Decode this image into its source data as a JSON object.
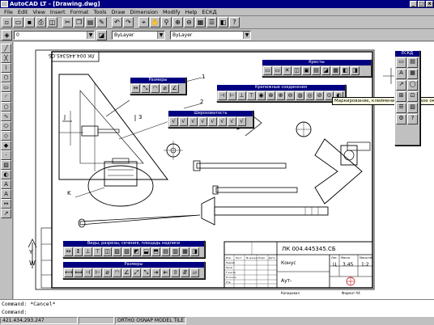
{
  "window": {
    "title": "AutoCAD LT - [Drawing.dwg]",
    "min": "_",
    "max": "□",
    "close": "x"
  },
  "menu": [
    "File",
    "Edit",
    "View",
    "Insert",
    "Format",
    "Tools",
    "Draw",
    "Dimension",
    "Modify",
    "Help",
    "ЕСКД"
  ],
  "props": {
    "layer": "0",
    "color": "ByLayer",
    "linetype": "ByLayer"
  },
  "panels": {
    "sizes": "Размеры",
    "roughness": "Шероховатость",
    "threaded": "Крепежные соединения",
    "crosses": "Кресты",
    "eskd": "ЕСКД",
    "views": "Виды, разрезы, сечения, площадь надписи",
    "dims": "Размеры"
  },
  "tooltip": "Маркирование, клеймение (диалоговое окно)",
  "drawing": {
    "stamp_code": "ЛК 004.445345.СБ",
    "stamp_code_rot": "ЛК 004.445345.СБ",
    "title_code": "ЛК 004.445345.СБ",
    "part_name": "Конус",
    "material": "Аут-",
    "lit": "Ц",
    "mass": "3.45",
    "scale": "1:2",
    "leader1": "1",
    "leader2": "2",
    "leader3": "3",
    "sec3": "3",
    "sec_j": "J",
    "view_k": "K",
    "view_w": "W",
    "view_y": "Y",
    "col_izm": "Изм",
    "col_list": "Лист",
    "col_doc": "№ докум.",
    "col_sign": "Подп.",
    "col_date": "Дата",
    "row_dev": "Разраб.",
    "row_chk": "Пров.",
    "row_tkon": "Т.контр.",
    "row_nk": "Н.контр.",
    "row_utv": "Утв.",
    "hdr_lit": "Лит.",
    "hdr_mass": "Масса",
    "hdr_scale": "Масштаб",
    "copied": "Копировал",
    "format": "Формат А4"
  },
  "command": {
    "line1": "Command: *Cancel*",
    "line2": "Command:"
  },
  "status": {
    "coords": "421.434,293.247",
    "modes": "ORTHO OSNAP MODEL TILE"
  }
}
